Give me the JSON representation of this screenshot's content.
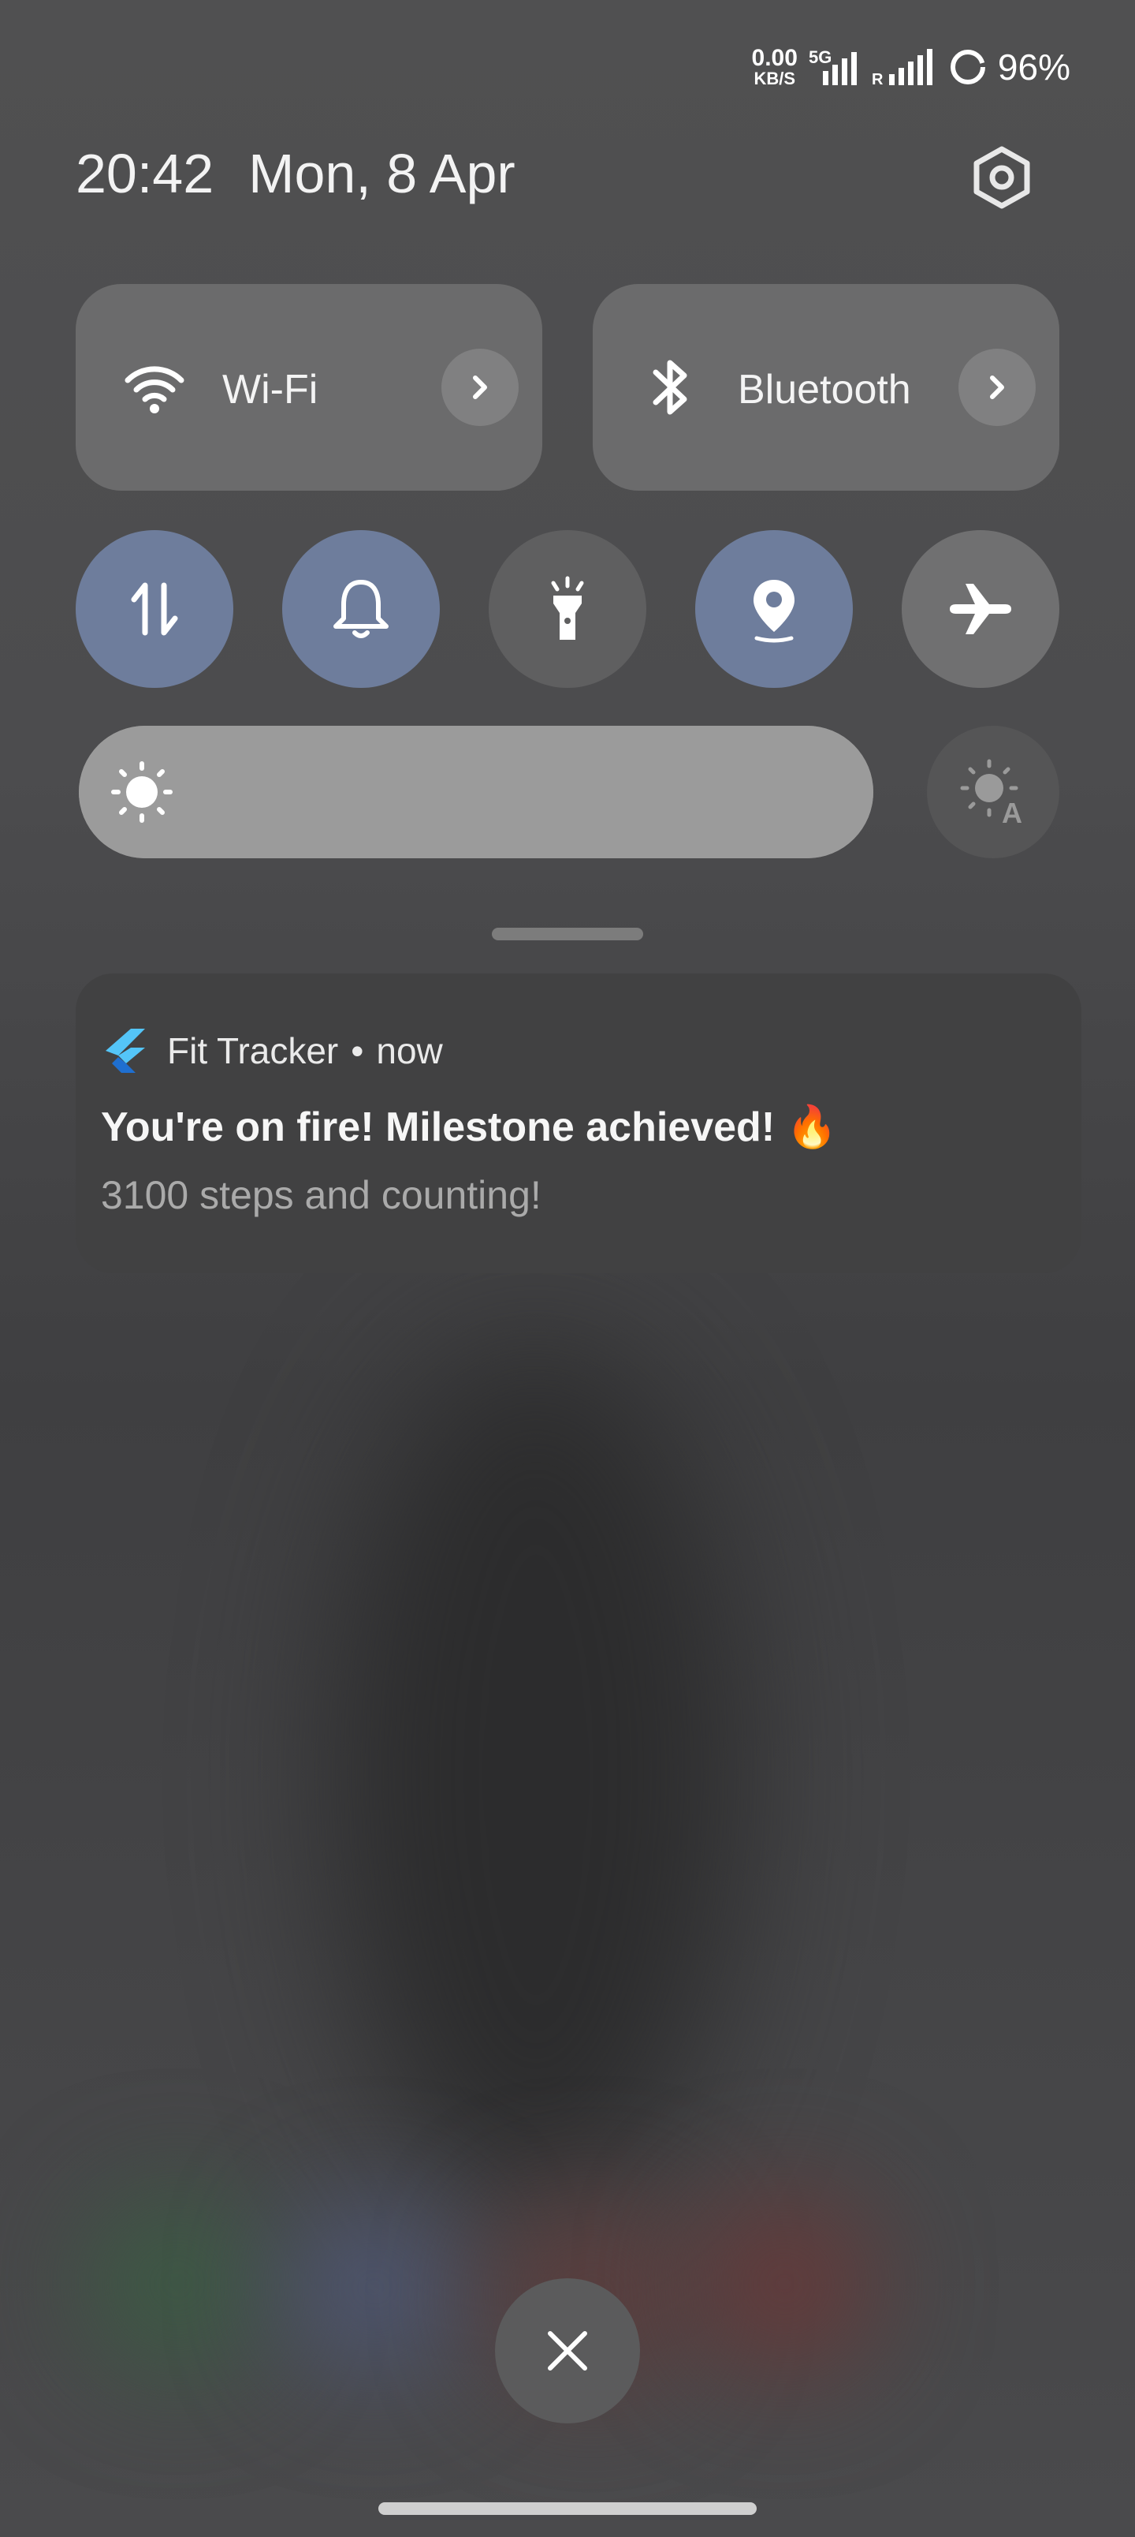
{
  "status_bar": {
    "net_speed_value": "0.00",
    "net_speed_unit": "KB/S",
    "network_type": "5G",
    "roaming_mark": "R",
    "battery": "96%"
  },
  "header": {
    "time": "20:42",
    "date": "Mon, 8 Apr",
    "settings_icon": "gear-icon"
  },
  "tiles": {
    "wifi": {
      "label": "Wi-Fi",
      "icon": "wifi-icon"
    },
    "bluetooth": {
      "label": "Bluetooth",
      "icon": "bluetooth-icon"
    }
  },
  "toggles": [
    {
      "name": "mobile-data",
      "icon": "data-arrows-icon",
      "active": true
    },
    {
      "name": "sound",
      "icon": "bell-icon",
      "active": true
    },
    {
      "name": "flashlight",
      "icon": "flashlight-icon",
      "active": false
    },
    {
      "name": "location",
      "icon": "location-pin-icon",
      "active": true
    },
    {
      "name": "airplane-mode",
      "icon": "airplane-icon",
      "active": false
    }
  ],
  "brightness": {
    "level": 1.0,
    "auto_label": "A"
  },
  "notification": {
    "app": "Fit Tracker",
    "separator": "•",
    "time": "now",
    "title": "You're on fire! Milestone achieved! 🔥",
    "body": "3100 steps and counting!"
  },
  "colors": {
    "active_toggle": "#6e7d9c",
    "inactive_toggle": "#5f5f60",
    "airplane_toggle": "#707071",
    "tile_bg": "#6b6b6c",
    "notification_bg": "#414142",
    "app_icon_light": "#54c5f8",
    "app_icon_dark": "#1f6fd0"
  }
}
